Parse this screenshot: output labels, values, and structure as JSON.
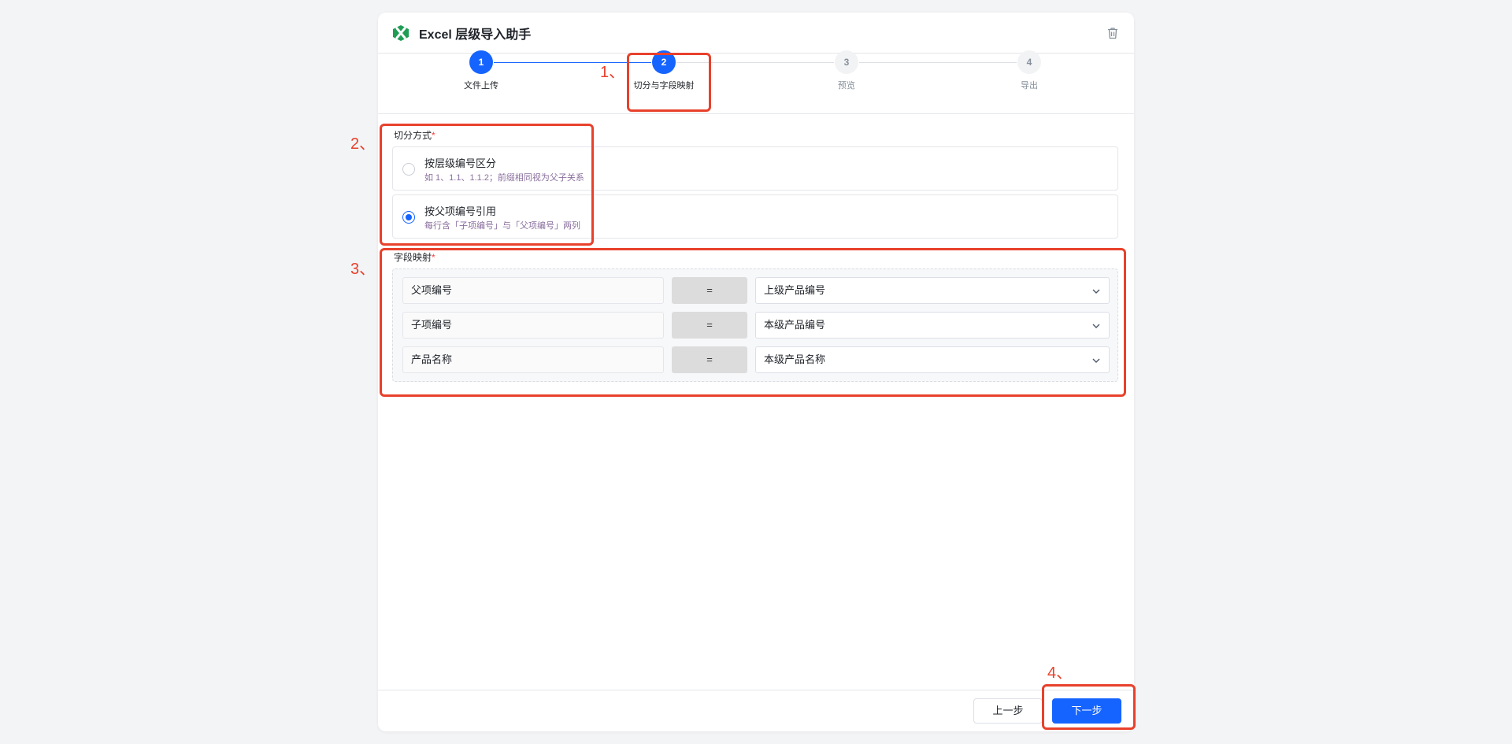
{
  "app": {
    "title": "Excel 层级导入助手",
    "logo_icon": "excel-icon",
    "accent_color": "#1664ff"
  },
  "steps": [
    {
      "number": "1",
      "label": "文件上传",
      "state": "done"
    },
    {
      "number": "2",
      "label": "切分与字段映射",
      "state": "active"
    },
    {
      "number": "3",
      "label": "预览",
      "state": "pending"
    },
    {
      "number": "4",
      "label": "导出",
      "state": "pending"
    }
  ],
  "split": {
    "label": "切分方式",
    "required_mark": "*",
    "options": [
      {
        "title": "按层级编号区分",
        "desc": "如 1、1.1、1.1.2；前缀相同视为父子关系",
        "checked": false
      },
      {
        "title": "按父项编号引用",
        "desc": "每行含「子项编号」与「父项编号」两列",
        "checked": true
      }
    ]
  },
  "mapping": {
    "label": "字段映射",
    "required_mark": "*",
    "rows": [
      {
        "source": "父项编号",
        "eq": "=",
        "target": "上级产品编号"
      },
      {
        "source": "子项编号",
        "eq": "=",
        "target": "本级产品编号"
      },
      {
        "source": "产品名称",
        "eq": "=",
        "target": "本级产品名称"
      }
    ]
  },
  "footer": {
    "prev_label": "上一步",
    "next_label": "下一步"
  },
  "annotations": {
    "n1": "1、",
    "n2": "2、",
    "n3": "3、",
    "n4": "4、",
    "color": "#e8412c"
  }
}
